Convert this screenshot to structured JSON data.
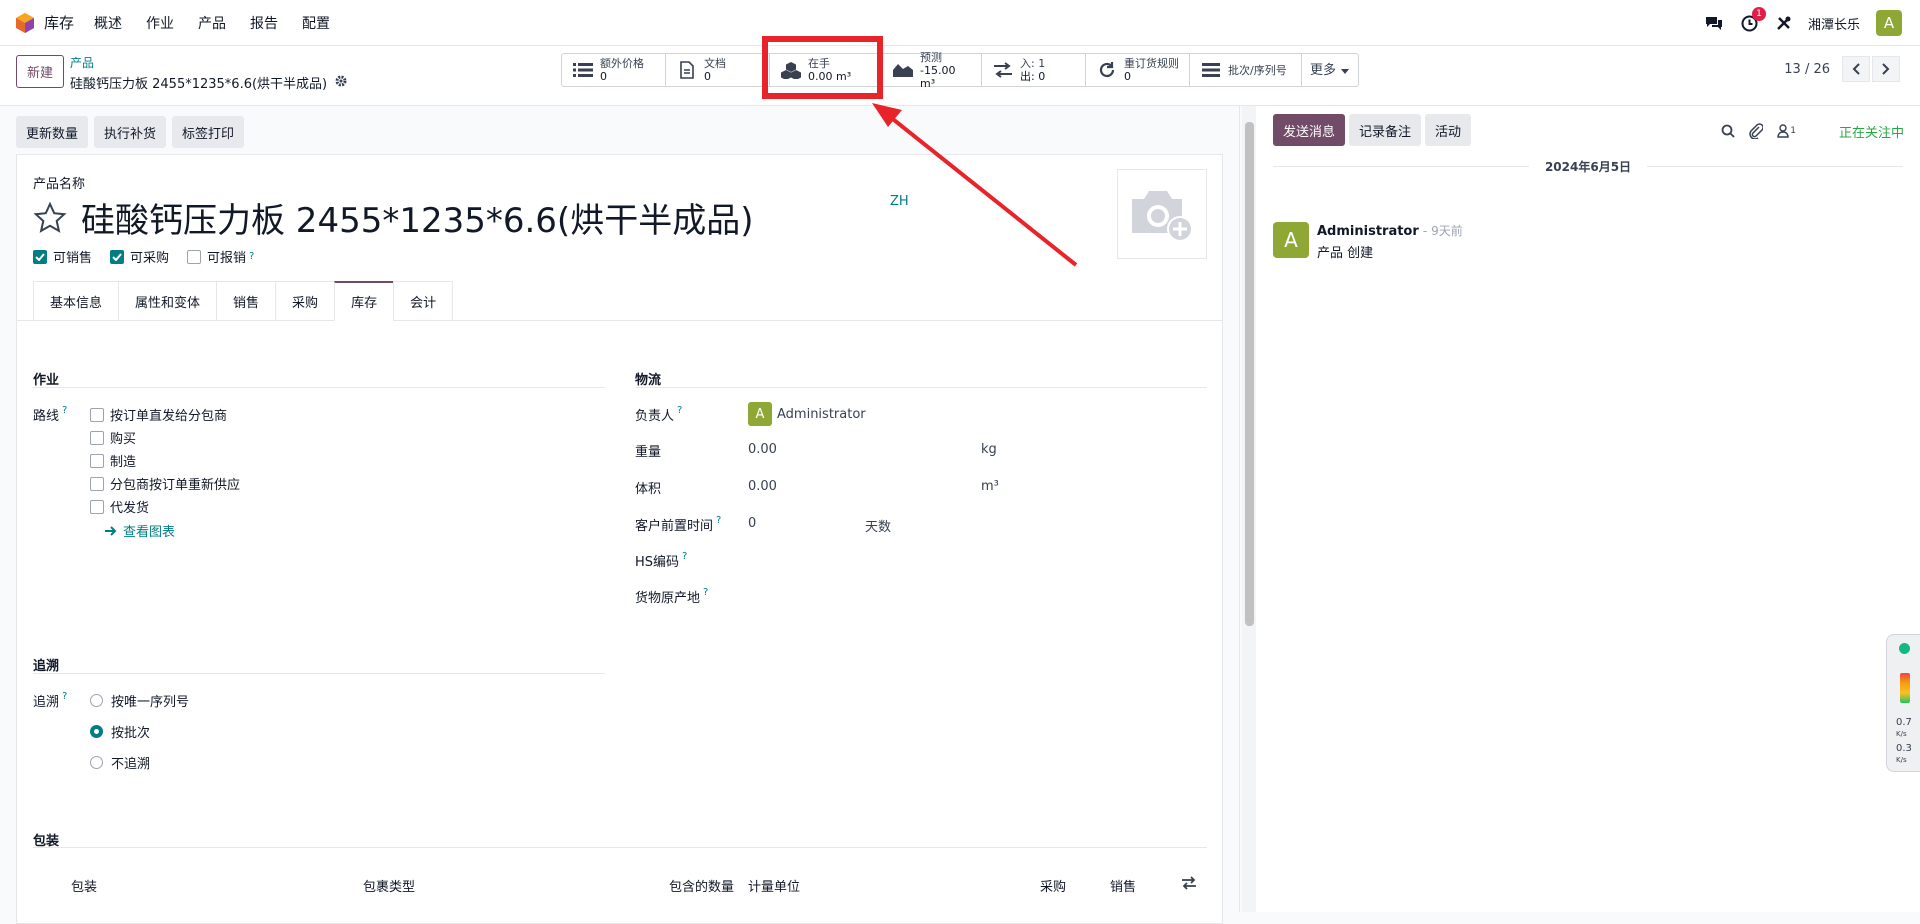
{
  "navbar": {
    "app_name": "库存",
    "menu": [
      "概述",
      "作业",
      "产品",
      "报告",
      "配置"
    ],
    "activity_badge": "1",
    "company": "湘潭长乐",
    "user_initial": "A"
  },
  "control": {
    "new_label": "新建",
    "breadcrumb_parent": "产品",
    "breadcrumb_current": "硅酸钙压力板 2455*1235*6.6(烘干半成品)",
    "smart_buttons": [
      {
        "title": "额外价格",
        "value": "0",
        "icon": "list-icon"
      },
      {
        "title": "文档",
        "value": "0",
        "icon": "document-icon"
      },
      {
        "title": "在手",
        "value": "0.00 m³",
        "icon": "cubes-icon"
      },
      {
        "title": "预测",
        "value": "-15.00 m³",
        "icon": "area-chart-icon"
      },
      {
        "title": "入:  1",
        "value": "出:  0",
        "icon": "exchange-icon"
      },
      {
        "title": "重订货规则",
        "value": "0",
        "icon": "refresh-icon"
      },
      {
        "title": "批次/序列号",
        "value": "",
        "icon": "bars-icon"
      },
      {
        "title": "更多",
        "value": "",
        "icon": "caret-down-icon"
      }
    ],
    "pager": "13 / 26"
  },
  "actions": [
    "更新数量",
    "执行补货",
    "标签打印"
  ],
  "form": {
    "name_label": "产品名称",
    "product_name": "硅酸钙压力板 2455*1235*6.6(烘干半成品)",
    "lang": "ZH",
    "checkboxes": [
      {
        "label": "可销售",
        "checked": true
      },
      {
        "label": "可采购",
        "checked": true
      },
      {
        "label": "可报销",
        "checked": false,
        "help": "?"
      }
    ],
    "tabs": [
      "基本信息",
      "属性和变体",
      "销售",
      "采购",
      "库存",
      "会计"
    ],
    "active_tab": "库存",
    "operations": {
      "title": "作业",
      "routes_label": "路线",
      "routes": [
        "按订单直发给分包商",
        "购买",
        "制造",
        "分包商按订单重新供应",
        "代发货"
      ],
      "view_diagram": "查看图表"
    },
    "logistics": {
      "title": "物流",
      "responsible_label": "负责人",
      "responsible": "Administrator",
      "weight_label": "重量",
      "weight": "0.00",
      "weight_unit": "kg",
      "volume_label": "体积",
      "volume": "0.00",
      "volume_unit": "m³",
      "lead_label": "客户前置时间",
      "lead": "0",
      "lead_unit": "天数",
      "hs_label": "HS编码",
      "origin_label": "货物原产地"
    },
    "tracking": {
      "title": "追溯",
      "label": "追溯",
      "options": [
        "按唯一序列号",
        "按批次",
        "不追溯"
      ],
      "selected": "按批次"
    },
    "packaging": {
      "title": "包装",
      "columns": [
        "包装",
        "包裹类型",
        "包含的数量",
        "计量单位",
        "采购",
        "销售"
      ]
    }
  },
  "chatter": {
    "send_message": "发送消息",
    "log_note": "记录备注",
    "activity": "活动",
    "followers_count": "1",
    "following": "正在关注中",
    "date": "2024年6月5日",
    "message": {
      "author": "Administrator",
      "time": "- 9天前",
      "text": "产品 创建",
      "initial": "A"
    }
  },
  "widget": {
    "up": "0.7",
    "down": "0.3",
    "unit": "K/s"
  },
  "colors": {
    "primary": "#714b67",
    "accent": "#017e84",
    "highlight": "#e8232a",
    "avatar": "#8fa835"
  }
}
